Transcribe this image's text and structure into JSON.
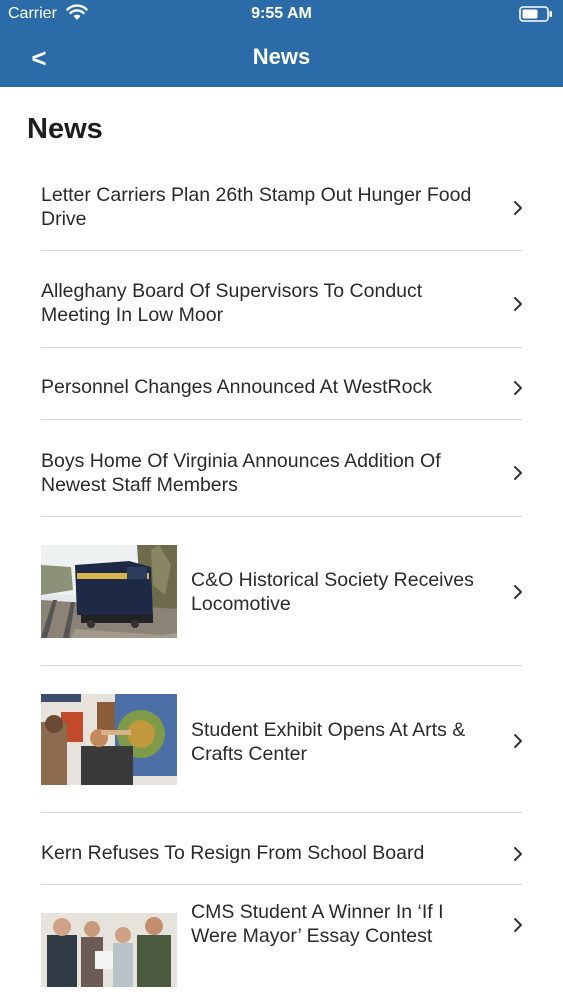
{
  "status_bar": {
    "carrier": "Carrier",
    "time": "9:55 AM"
  },
  "nav": {
    "back_label": "<",
    "title": "News"
  },
  "page_title": "News",
  "articles": [
    {
      "title": "Letter Carriers Plan 26th Stamp Out Hunger Food Drive",
      "thumbnail": null
    },
    {
      "title": "Alleghany Board Of Supervisors To Conduct Meeting In Low Moor",
      "thumbnail": null
    },
    {
      "title": "Personnel Changes Announced At WestRock",
      "thumbnail": null
    },
    {
      "title": "Boys Home Of Virginia Announces Addition Of Newest Staff Members",
      "thumbnail": null
    },
    {
      "title": "C&O Historical Society Receives Locomotive",
      "thumbnail": "locomotive-photo"
    },
    {
      "title": "Student Exhibit Opens At Arts & Crafts Center",
      "thumbnail": "art-exhibit-photo"
    },
    {
      "title": "Kern Refuses To Resign From School Board",
      "thumbnail": null
    },
    {
      "title": "CMS Student A Winner In ‘If I Were Mayor’ Essay Contest",
      "thumbnail": "award-group-photo"
    }
  ],
  "colors": {
    "header": "#2b6ca8",
    "divider": "#d9d9d9"
  }
}
